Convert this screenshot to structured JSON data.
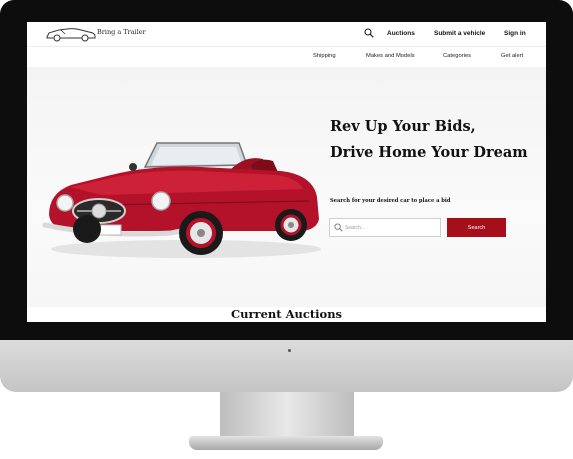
{
  "brand": {
    "name": "Bring a Trailer"
  },
  "header": {
    "search_icon": "search-icon",
    "links": [
      "Auctions",
      "Submit a vehicle",
      "Sign in"
    ]
  },
  "subnav": {
    "links": [
      "Shipping",
      "Makes and Models",
      "Categories",
      "Get alert"
    ]
  },
  "hero": {
    "headline_line1": "Rev Up Your Bids,",
    "headline_line2": "Drive Home Your Dream",
    "search_hint": "Search for your desired car to place a bid",
    "search_placeholder": "Search...",
    "search_button": "Search",
    "image_subject": "red vintage convertible car"
  },
  "sections": {
    "current_auctions_title": "Current Auctions"
  },
  "colors": {
    "accent": "#a50f1b",
    "car_body": "#b3122a",
    "hero_background": "#f5f5f5",
    "monitor_bezel": "#0d0d0d",
    "monitor_chin": "#d0d0d0"
  }
}
